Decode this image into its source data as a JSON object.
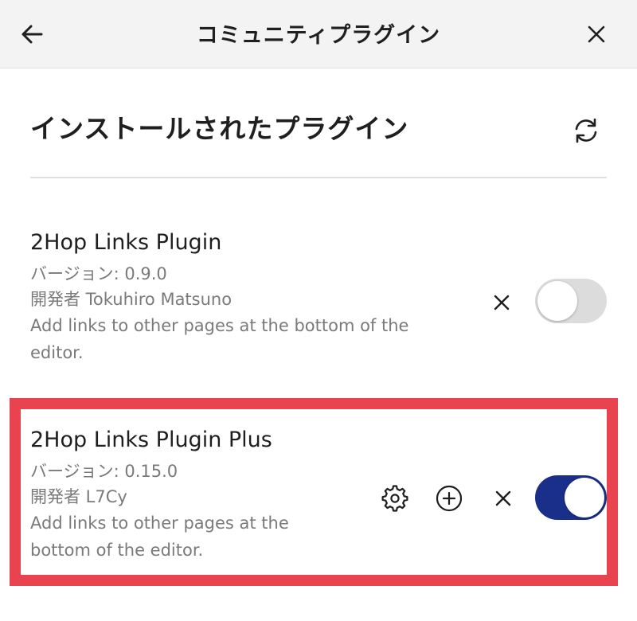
{
  "header": {
    "title": "コミュニティプラグイン"
  },
  "installed": {
    "heading": "インストールされたプラグイン"
  },
  "plugins": [
    {
      "name": "2Hop Links Plugin",
      "version": "バージョン: 0.9.0",
      "author": "開発者 Tokuhiro Matsuno",
      "description": "Add links to other pages at the bottom of the editor.",
      "enabled": false
    },
    {
      "name": "2Hop Links Plugin Plus",
      "version": "バージョン: 0.15.0",
      "author": "開発者 L7Cy",
      "description": "Add links to other pages at the bottom of the editor.",
      "enabled": true
    }
  ],
  "colors": {
    "highlight": "#e8434f",
    "toggle_on": "#1a2f8a",
    "toggle_off": "#dcdcdc"
  },
  "icons": [
    "arrow-left-icon",
    "close-icon",
    "refresh-icon",
    "gear-icon",
    "plus-circle-icon",
    "uninstall-icon"
  ]
}
